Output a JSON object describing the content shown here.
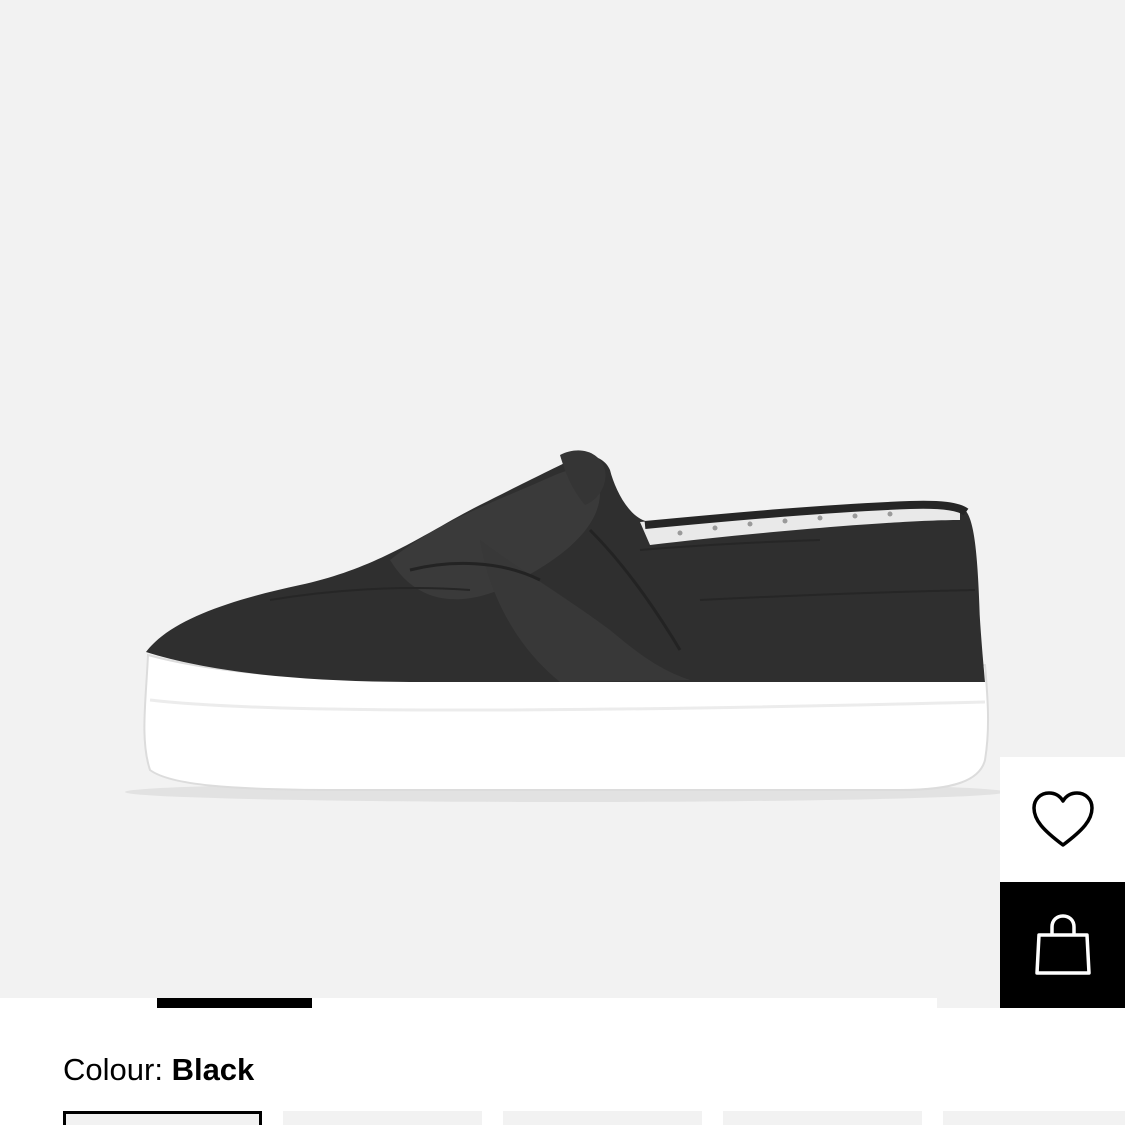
{
  "product": {
    "colour_label": "Colour:",
    "colour_value": "Black"
  },
  "gallery": {
    "image_count": 6,
    "active_index": 1
  },
  "actions": {
    "wishlist_icon": "heart-outline-icon",
    "bag_icon": "shopping-bag-icon"
  },
  "colour_swatches": {
    "count": 5,
    "selected_index": 0
  },
  "colors": {
    "background": "#f2f2f2",
    "accent": "#000000",
    "shoe_canvas": "#2f2f2f",
    "sole": "#ffffff"
  }
}
